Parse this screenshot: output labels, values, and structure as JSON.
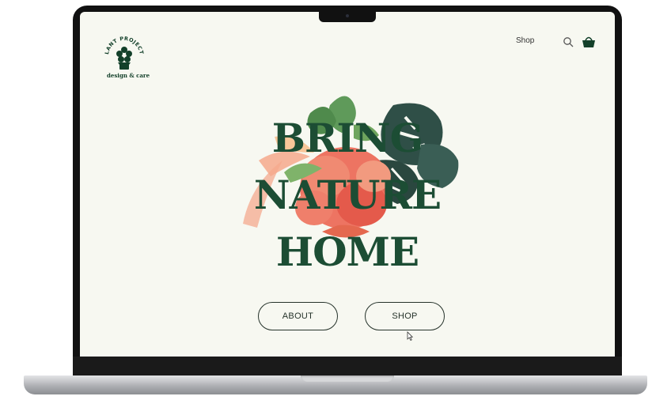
{
  "brand": {
    "logo_arc_text": "PLANT PROJECTS",
    "tagline": "design & care"
  },
  "nav": {
    "shop_label": "Shop",
    "search_icon": "search-icon",
    "cart_icon": "basket-icon"
  },
  "hero": {
    "headline_lines": [
      "BRING",
      "NATURE",
      "HOME"
    ]
  },
  "buttons": {
    "about_label": "ABOUT",
    "shop_label": "SHOP"
  },
  "colors": {
    "brand_green": "#1c4d34",
    "background": "#f7f8f1",
    "coral": "#ec6d5a"
  }
}
